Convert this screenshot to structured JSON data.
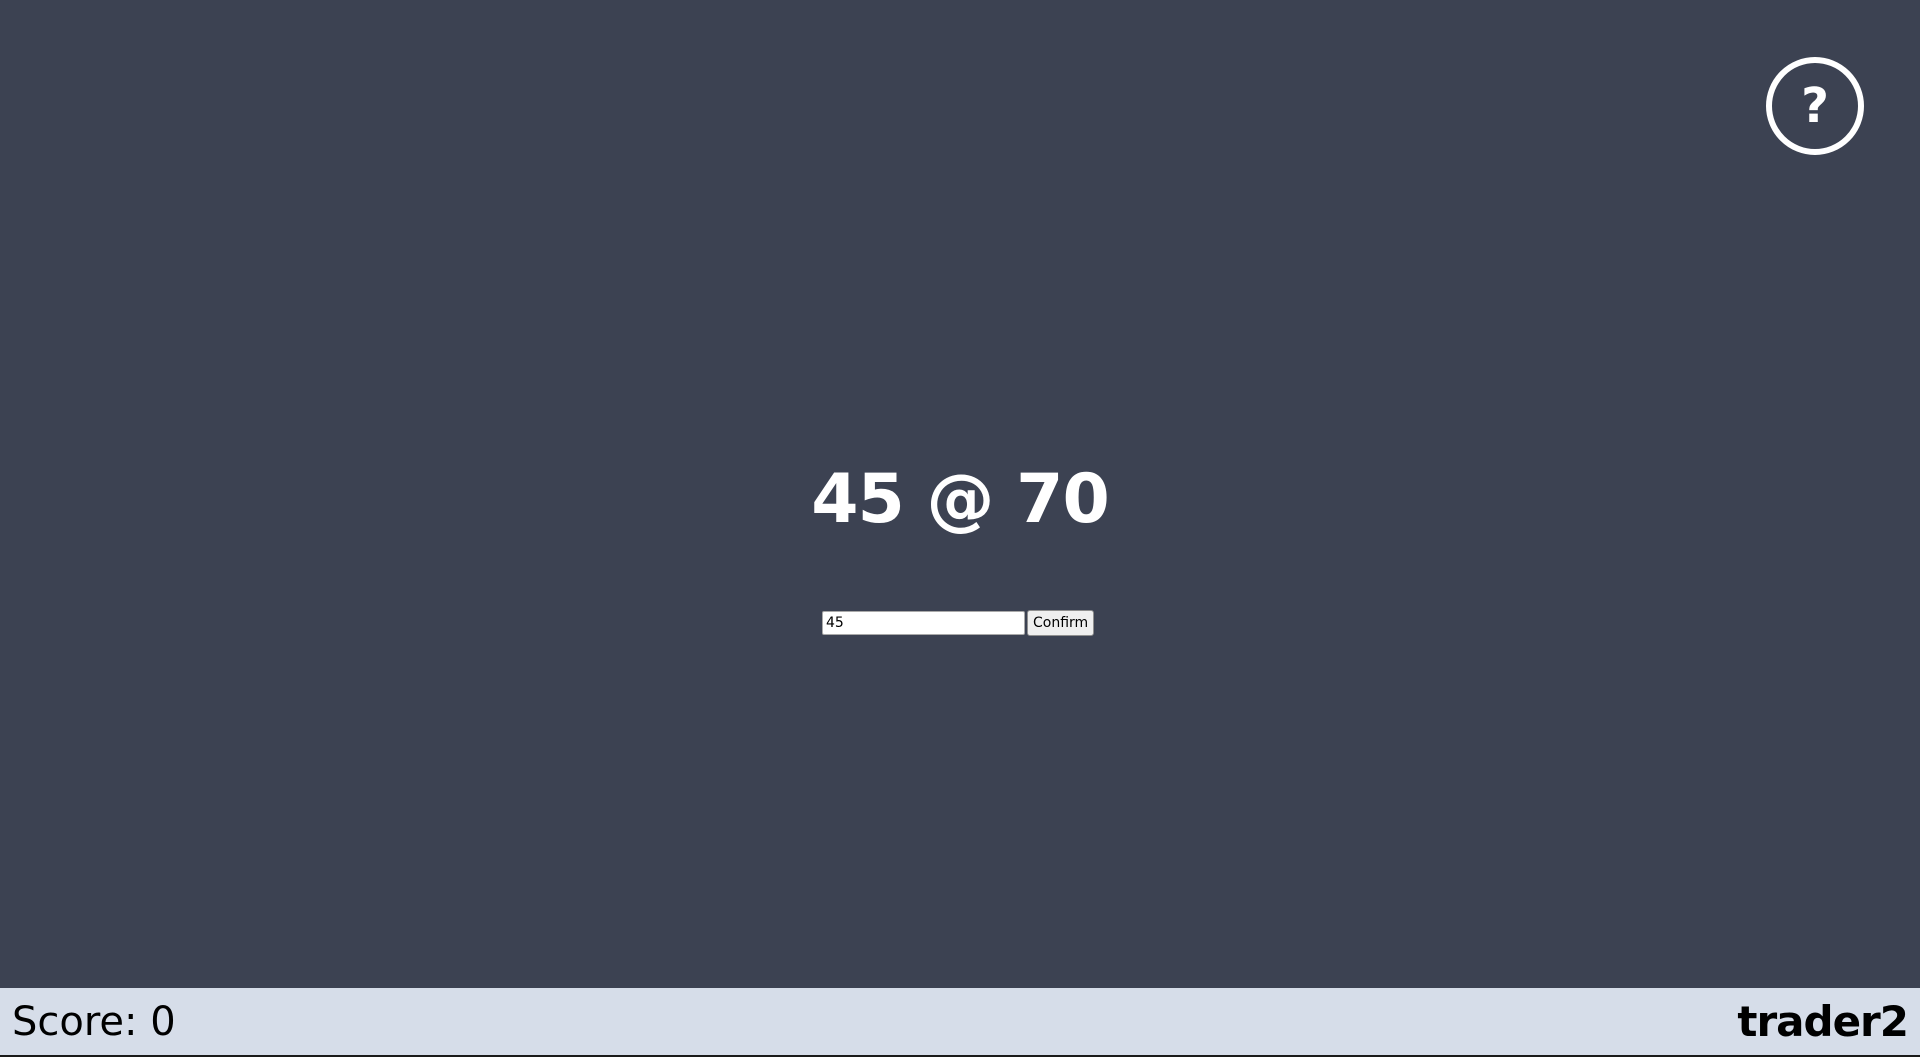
{
  "help": {
    "icon": "question-circle-icon",
    "glyph": "?"
  },
  "quote": {
    "text": "45 @ 70"
  },
  "entry": {
    "input_value": "45",
    "confirm_label": "Confirm"
  },
  "footer": {
    "score_text": "Score: 0",
    "username": "trader2"
  },
  "colors": {
    "background": "#3c4252",
    "footer_background": "#d6dde9",
    "text_light": "#ffffff",
    "text_dark": "#000000"
  }
}
